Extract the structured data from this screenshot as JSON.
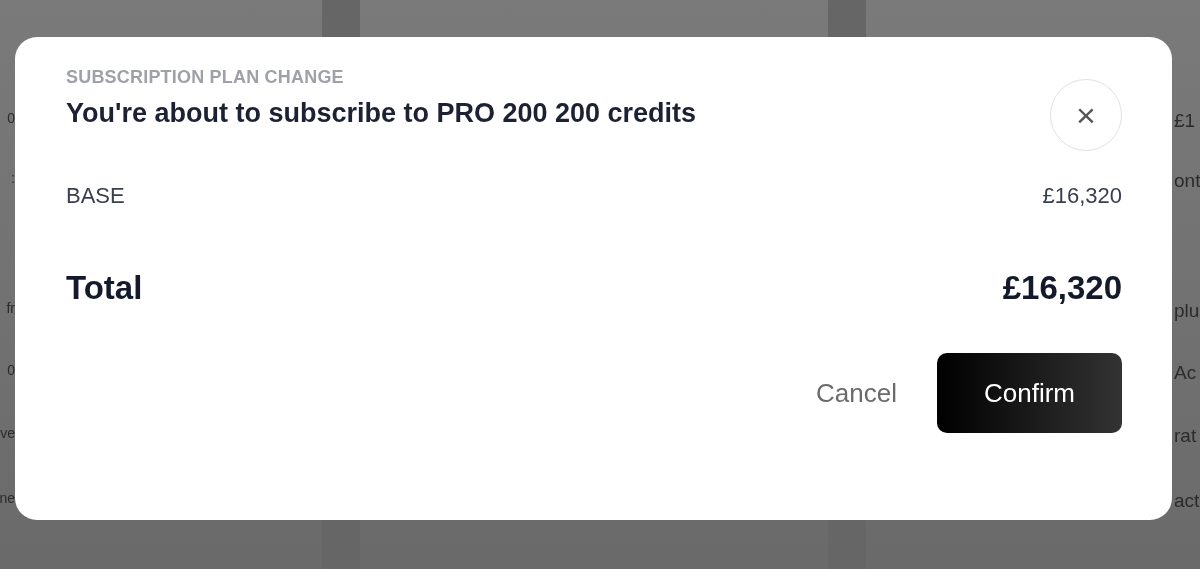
{
  "background": {
    "left_fragments": [
      "0",
      ":",
      "fr",
      "0",
      "ve",
      "ne"
    ],
    "right_fragments": [
      "£1",
      "ont",
      "plu",
      "Ac",
      "rat",
      "act"
    ]
  },
  "dialog": {
    "eyebrow": "SUBSCRIPTION PLAN CHANGE",
    "title": "You're about to subscribe to PRO 200 200 credits",
    "close_label": "×",
    "lines": [
      {
        "kind": "item",
        "label": "BASE",
        "amount": "£16,320"
      },
      {
        "kind": "total",
        "label": "Total",
        "amount": "£16,320"
      }
    ],
    "buttons": [
      {
        "kind": "secondary",
        "label": "Cancel"
      },
      {
        "kind": "primary",
        "label": "Confirm"
      }
    ]
  }
}
